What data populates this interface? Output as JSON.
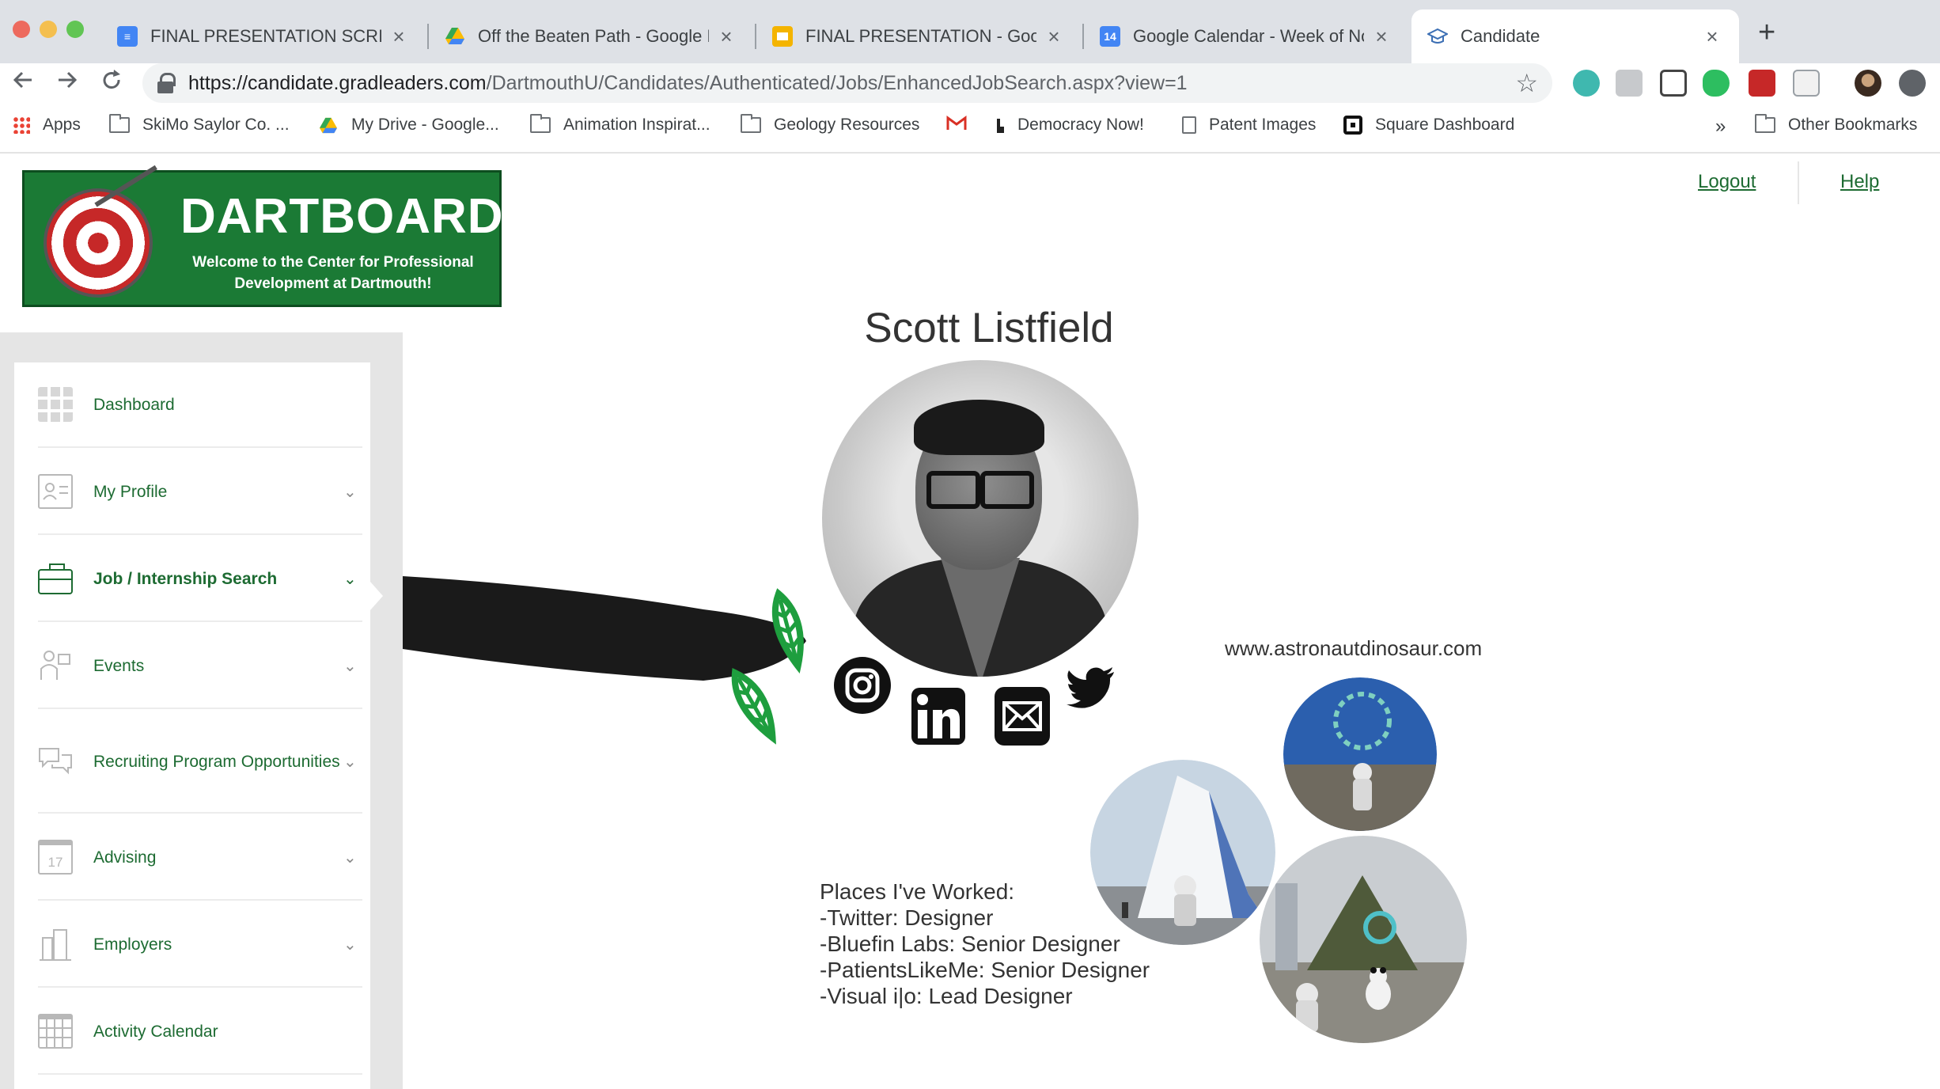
{
  "browser": {
    "tabs": [
      {
        "title": "FINAL PRESENTATION SCRIPT",
        "favicon": "docs-icon"
      },
      {
        "title": "Off the Beaten Path - Google D",
        "favicon": "drive-icon"
      },
      {
        "title": "FINAL PRESENTATION - Googl",
        "favicon": "slides-icon"
      },
      {
        "title": "Google Calendar - Week of No",
        "favicon": "calendar-icon",
        "favicon_text": "14"
      },
      {
        "title": "Candidate",
        "favicon": "graduation-cap-icon"
      }
    ],
    "url_host": "https://candidate.gradleaders.com",
    "url_path": "/DartmouthU/Candidates/Authenticated/Jobs/EnhancedJobSearch.aspx?view=1",
    "bookmarks": [
      {
        "label": "Apps",
        "icon": "apps-grid-icon"
      },
      {
        "label": "SkiMo Saylor Co. ...",
        "icon": "folder-icon"
      },
      {
        "label": "My Drive - Google...",
        "icon": "drive-icon"
      },
      {
        "label": "Animation Inspirat...",
        "icon": "folder-icon"
      },
      {
        "label": "Geology Resources",
        "icon": "folder-icon"
      },
      {
        "label": "",
        "icon": "gmail-icon"
      },
      {
        "label": "Democracy Now!",
        "icon": "democracy-now-icon"
      },
      {
        "label": "Patent Images",
        "icon": "page-icon"
      },
      {
        "label": "Square Dashboard",
        "icon": "square-icon"
      }
    ],
    "overflow": "»",
    "other_bookmarks": "Other Bookmarks"
  },
  "header": {
    "brand": "DARTBOARD",
    "tagline": "Welcome to the Center for Professional Development at Dartmouth!",
    "logout": "Logout",
    "help": "Help"
  },
  "sidebar": {
    "items": [
      {
        "label": "Dashboard",
        "icon": "dashboard-grid-icon",
        "expandable": false
      },
      {
        "label": "My Profile",
        "icon": "profile-card-icon",
        "expandable": true
      },
      {
        "label": "Job / Internship Search",
        "icon": "briefcase-icon",
        "expandable": true,
        "active": true
      },
      {
        "label": "Events",
        "icon": "events-icon",
        "expandable": true
      },
      {
        "label": "Recruiting Program Opportunities",
        "icon": "chat-bubbles-icon",
        "expandable": true
      },
      {
        "label": "Advising",
        "icon": "calendar-17-icon",
        "expandable": true,
        "icon_text": "17"
      },
      {
        "label": "Employers",
        "icon": "buildings-icon",
        "expandable": true
      },
      {
        "label": "Activity Calendar",
        "icon": "calendar-grid-icon",
        "expandable": false
      }
    ],
    "chevron": "⌄"
  },
  "portfolio": {
    "name": "Scott Listfield",
    "website": "www.astronautdinosaur.com",
    "social": [
      "instagram-icon",
      "linkedin-icon",
      "email-icon",
      "twitter-icon"
    ],
    "places_heading": "Places I've Worked:",
    "places": [
      "-Twitter: Designer",
      "-Bluefin Labs: Senior Designer",
      "-PatientsLikeMe: Senior Designer",
      "-Visual i|o: Lead Designer"
    ]
  },
  "colors": {
    "accent_green": "#1d6b32",
    "logo_green": "#1b7a35",
    "tabbar": "#dee1e6"
  }
}
